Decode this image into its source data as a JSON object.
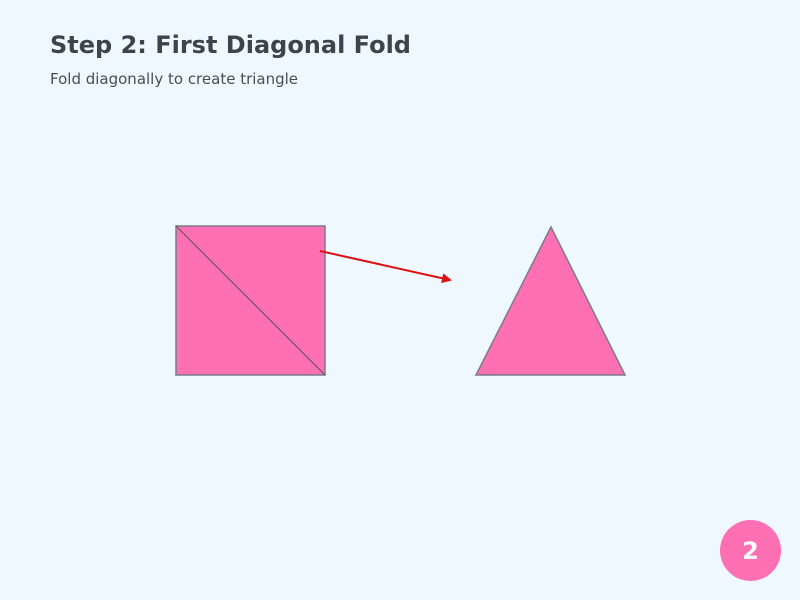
{
  "step": {
    "title": "Step 2: First Diagonal Fold",
    "instruction": "Fold diagonally to create triangle",
    "number": "2"
  },
  "colors": {
    "background": "#f0f8ff",
    "paper": "#ff6fb3",
    "paper_edge": "#7a7a8a",
    "arrow": "#dd1111",
    "badge": "#ff6fb3",
    "title_text": "#404448"
  },
  "icons": {
    "before": "square-paper-with-diagonal-fold",
    "transition": "arrow-right-icon",
    "after": "triangle-paper"
  }
}
